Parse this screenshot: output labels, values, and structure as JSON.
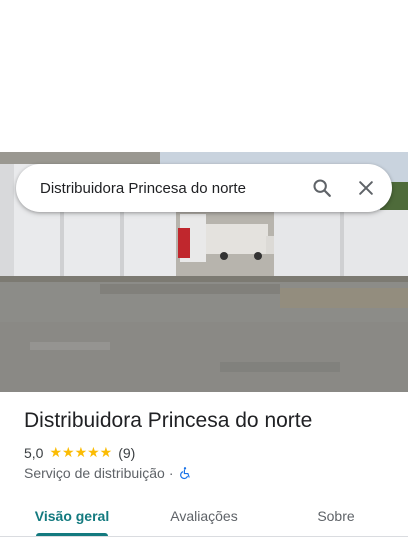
{
  "search": {
    "query": "Distribuidora Princesa do norte"
  },
  "place": {
    "name": "Distribuidora Princesa do norte",
    "rating": "5,0",
    "stars": "★★★★★",
    "reviews": "(9)",
    "category": "Serviço de distribuição",
    "separator": "·"
  },
  "tabs": [
    {
      "label": "Visão geral",
      "active": true
    },
    {
      "label": "Avaliações",
      "active": false
    },
    {
      "label": "Sobre",
      "active": false
    }
  ],
  "colors": {
    "accent": "#137a7f",
    "star": "#fbbc04",
    "accessibility": "#1a73e8"
  },
  "icons": [
    "search-icon",
    "close-icon",
    "wheelchair-icon"
  ]
}
